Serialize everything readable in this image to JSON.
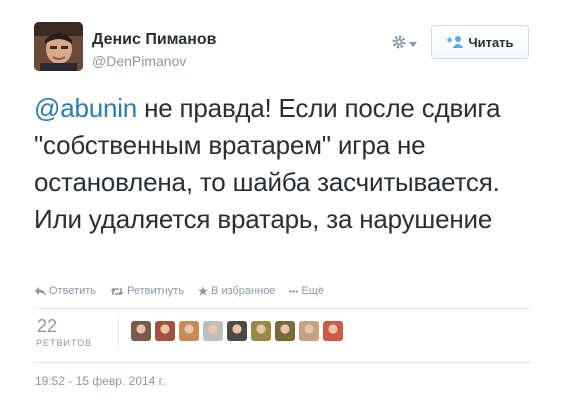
{
  "author": {
    "name": "Денис Пиманов",
    "handle": "@DenPimanov"
  },
  "header": {
    "follow_label": "Читать"
  },
  "tweet": {
    "mention": "@abunin",
    "text": " не правда! Если после сдвига \"собственным вратарем\" игра не остановлена, то шайба засчитывается. Или удаляется вратарь, за нарушение"
  },
  "actions": {
    "reply": "Ответить",
    "retweet": "Ретвитнуть",
    "favorite": "В избранное",
    "more": "Ещё"
  },
  "stats": {
    "retweet_count": "22",
    "retweet_label": "РЕТВИТОВ"
  },
  "retweeter_avatars": [
    {
      "color": "#7a5a4a"
    },
    {
      "color": "#a0523a"
    },
    {
      "color": "#c98a55"
    },
    {
      "color": "#bdbdbd"
    },
    {
      "color": "#4a4a4a"
    },
    {
      "color": "#9a8a4a"
    },
    {
      "color": "#7a6a3a"
    },
    {
      "color": "#c9a080"
    },
    {
      "color": "#d05a4a"
    }
  ],
  "timestamp": "19:52 - 15 февр. 2014 г.",
  "colors": {
    "link": "#2b7bb9",
    "muted": "#8899a6",
    "accent": "#55acee"
  }
}
